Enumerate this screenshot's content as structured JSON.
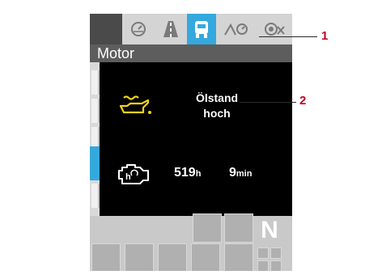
{
  "tabs": [
    {
      "id": "speed",
      "icon": "speedometer-icon"
    },
    {
      "id": "road",
      "icon": "road-icon"
    },
    {
      "id": "motor",
      "icon": "engine-tab-icon",
      "active": true
    },
    {
      "id": "fuel",
      "icon": "fuel-consumption-icon"
    },
    {
      "id": "camera",
      "icon": "camera-icon"
    }
  ],
  "panel": {
    "title": "Motor",
    "warning": {
      "icon": "oil-level-icon",
      "line1": "Ölstand",
      "line2": "hoch"
    },
    "operating_hours": {
      "icon": "engine-hours-icon",
      "hours": "519",
      "hours_unit": "h",
      "minutes": "9",
      "minutes_unit": "min"
    }
  },
  "gear_indicator": "N",
  "callouts": [
    "1",
    "2"
  ],
  "colors": {
    "accent": "#35a9dd",
    "warning_icon": "#f2d21b",
    "callout": "#c0002b",
    "panel_background": "#000000",
    "header_background": "#5d5d5d"
  }
}
